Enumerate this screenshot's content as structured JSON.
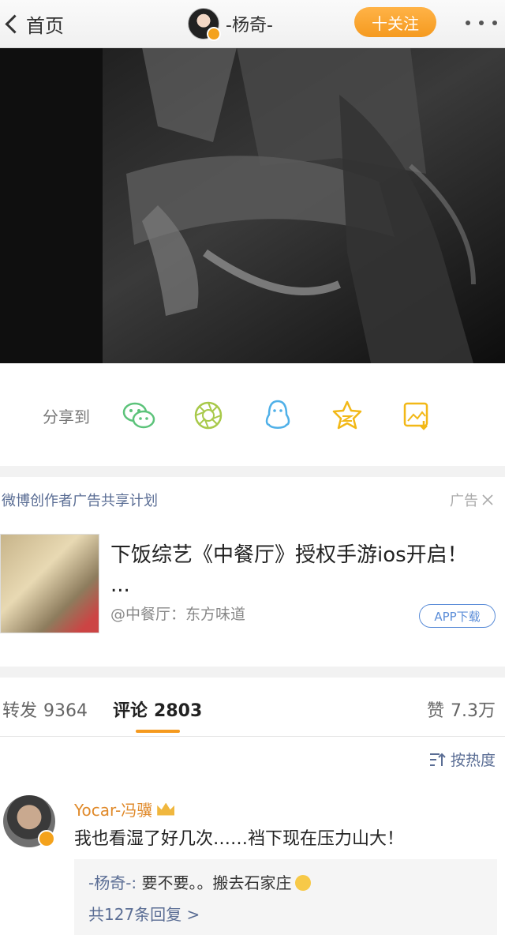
{
  "nav": {
    "back_label": "首页",
    "user_name": "-杨奇-",
    "follow_label": "十关注"
  },
  "share": {
    "label": "分享到",
    "targets": [
      "wechat-icon",
      "moments-icon",
      "qq-icon",
      "qzone-icon",
      "save-image-icon"
    ]
  },
  "ad": {
    "plan_label": "微博创作者广告共享计划",
    "tag_label": "广告",
    "title": "下饭综艺《中餐厅》授权手游ios开启！ ...",
    "source": "@中餐厅：东方味道",
    "app_button": "APP下载"
  },
  "tabs": {
    "repost_label": "转发",
    "repost_count": "9364",
    "comment_label": "评论",
    "comment_count": "2803",
    "like_label": "赞",
    "like_count": "7.3万"
  },
  "sort_label": "按热度",
  "comment": {
    "user": "Yocar-冯骥",
    "text": "我也看湿了好几次……裆下现在压力山大！",
    "reply_user": "-杨奇-:",
    "reply_text": " 要不要。。搬去石家庄",
    "reply_count": "共127条回复 >"
  },
  "colors": {
    "accent_orange": "#f59a1f",
    "link_blue": "#5a6d94",
    "share_green": "#5cc37a",
    "share_blue": "#4fb0e8",
    "share_yellow": "#f2b817"
  }
}
